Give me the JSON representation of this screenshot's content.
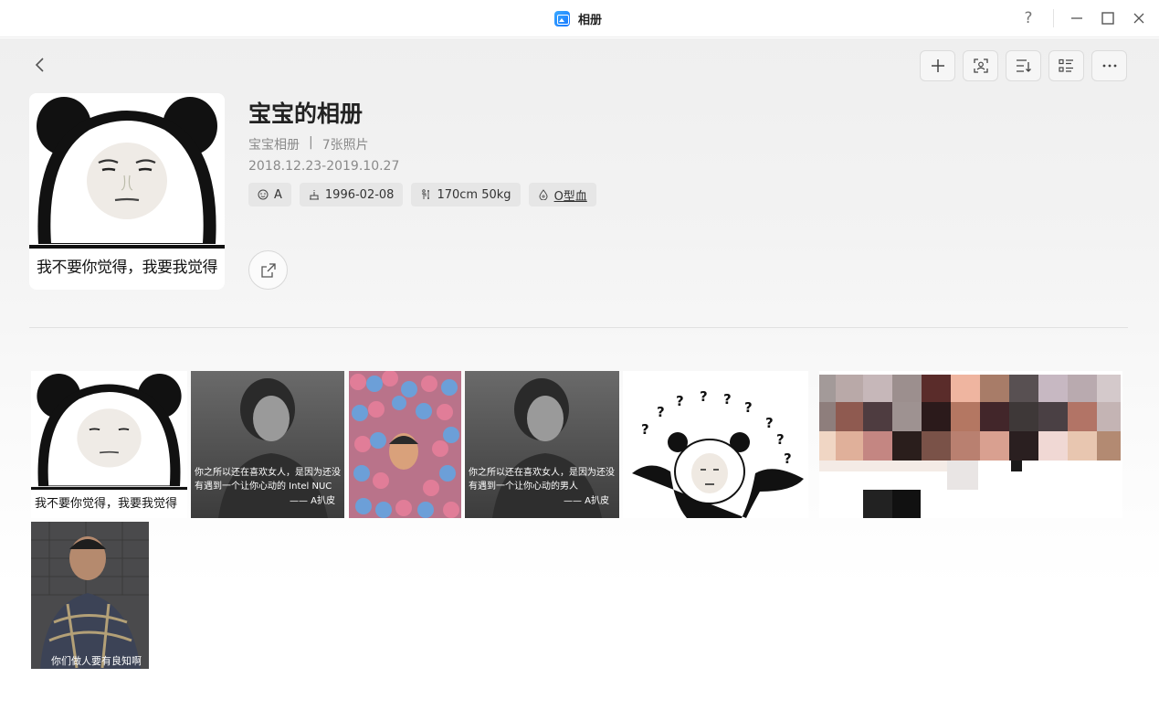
{
  "window": {
    "title": "相册",
    "help_label": "?"
  },
  "toolbar": {
    "add_icon": "plus-icon",
    "scan_icon": "face-scan-icon",
    "sort_icon": "sort-icon",
    "view_icon": "list-view-icon",
    "more_icon": "more-icon"
  },
  "album": {
    "cover_caption": "我不要你觉得，我要我觉得",
    "title": "宝宝的相册",
    "type": "宝宝相册",
    "separator": "|",
    "count": "7张照片",
    "date_range": "2018.12.23-2019.10.27",
    "chips": [
      {
        "icon": "face-icon",
        "label": "A"
      },
      {
        "icon": "birthday-cake-icon",
        "label": "1996-02-08"
      },
      {
        "icon": "height-weight-icon",
        "label": "170cm 50kg"
      },
      {
        "icon": "blood-drop-icon",
        "label": "O型血"
      }
    ]
  },
  "photos": {
    "p1_caption": "我不要你觉得，我要我觉得",
    "p2_line1": "你之所以还在喜欢女人，是因为还没",
    "p2_line2": "有遇到一个让你心动的 Intel NUC",
    "p2_sign": "—— A扒皮",
    "p4_line1": "你之所以还在喜欢女人，是因为还没",
    "p4_line2": "有遇到一个让你心动的男人",
    "p4_sign": "—— A扒皮",
    "p5_marks": "? ? ? ? ? ? ?",
    "p7_caption": "你们做人要有良知啊"
  },
  "colors": {
    "accent": "#1677ff",
    "chip_bg": "#e6e6e6",
    "meta_text": "#8a8a8a"
  }
}
